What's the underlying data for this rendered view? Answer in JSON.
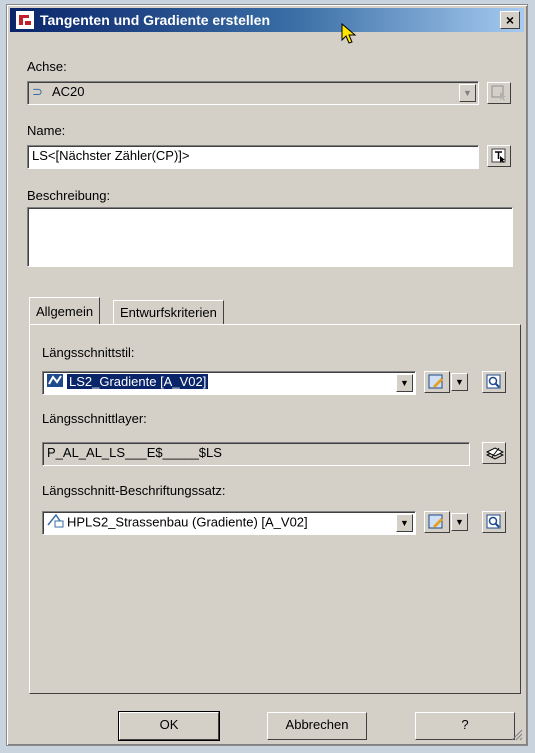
{
  "window": {
    "title": "Tangenten und Gradiente erstellen",
    "close_label": "×"
  },
  "alignment": {
    "label": "Achse:",
    "value": "AC20"
  },
  "name": {
    "label": "Name:",
    "value": "LS<[Nächster Zähler(CP)]>"
  },
  "description": {
    "label": "Beschreibung:",
    "value": ""
  },
  "tabs": [
    {
      "label": "Allgemein",
      "active": true
    },
    {
      "label": "Entwurfskriterien",
      "active": false
    }
  ],
  "general": {
    "style_label": "Längsschnittstil:",
    "style_value": "LS2_Gradiente [A_V02]",
    "layer_label": "Längsschnittlayer:",
    "layer_value": "P_AL_AL_LS___E$_____$LS",
    "labelset_label": "Längsschnitt-Beschriftungssatz:",
    "labelset_value": "HPLS2_Strassenbau (Gradiente) [A_V02]"
  },
  "buttons": {
    "ok": "OK",
    "cancel": "Abbrechen",
    "help": "?"
  },
  "icons": {
    "app": "civil3d-app-icon",
    "alignment": "alignment-icon",
    "pick": "pick-from-drawing-icon",
    "rename": "rename-icon",
    "style": "profile-style-icon",
    "edit": "edit-style-icon",
    "preview": "preview-icon",
    "layer": "layer-icon",
    "labelset": "label-set-icon"
  },
  "colors": {
    "selection": "#0a246a",
    "title_start": "#0a246a",
    "title_end": "#a6caf0"
  }
}
